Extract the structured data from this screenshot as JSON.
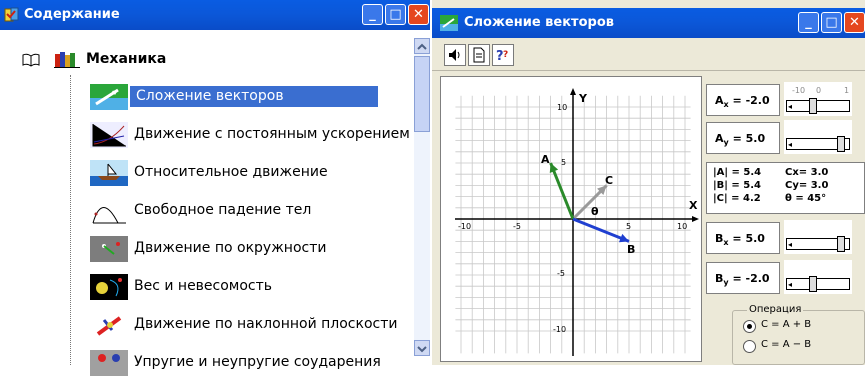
{
  "left_window": {
    "title": "Содержание",
    "root_label": "Механика",
    "items": [
      {
        "label": "Сложение векторов",
        "selected": true
      },
      {
        "label": "Движение с постоянным ускорением",
        "selected": false
      },
      {
        "label": "Относительное движение",
        "selected": false
      },
      {
        "label": "Свободное падение тел",
        "selected": false
      },
      {
        "label": "Движение по окружности",
        "selected": false
      },
      {
        "label": "Вес и невесомость",
        "selected": false
      },
      {
        "label": "Движение по наклонной плоскости",
        "selected": false
      },
      {
        "label": "Упругие и неупругие соударения",
        "selected": false
      }
    ]
  },
  "right_window": {
    "title": "Сложение векторов",
    "toolbar": [
      "sound-icon",
      "document-icon",
      "help-icon"
    ],
    "graph": {
      "y_axis_label": "Y",
      "x_axis_label": "X",
      "ticks": {
        "x_neg10": "-10",
        "x_neg5": "-5",
        "x_5": "5",
        "x_10": "10",
        "y_10": "10",
        "y_5": "5",
        "y_neg5": "-5",
        "y_neg10": "-10"
      },
      "vector_labels": {
        "a": "A",
        "b": "B",
        "c": "C"
      },
      "angle_label": "θ",
      "vectors": {
        "A": [
          -2.0,
          5.0
        ],
        "B": [
          5.0,
          -2.0
        ],
        "C": [
          3.0,
          3.0
        ]
      },
      "colors": {
        "A": "#2a8a2a",
        "B": "#1f3fd0",
        "C": "#9a9a9a"
      }
    },
    "controls": {
      "ax": {
        "name": "A",
        "sub": "x",
        "value": "= -2.0"
      },
      "ay": {
        "name": "A",
        "sub": "y",
        "value": "= 5.0"
      },
      "bx": {
        "name": "B",
        "sub": "x",
        "value": "= 5.0"
      },
      "by": {
        "name": "B",
        "sub": "y",
        "value": "= -2.0"
      },
      "slider_ticks": {
        "left": "-10",
        "mid": "0",
        "right": "1"
      },
      "stats": {
        "a_mag": "|A| = 5.4",
        "b_mag": "|B| = 5.4",
        "c_mag": "|C| = 4.2",
        "cx": "Cx= 3.0",
        "cy": "Cy= 3.0",
        "theta": "θ = 45°"
      },
      "operation": {
        "legend": "Операция",
        "options": [
          "C = A + B",
          "C = A − B"
        ],
        "selected": 0
      }
    }
  }
}
